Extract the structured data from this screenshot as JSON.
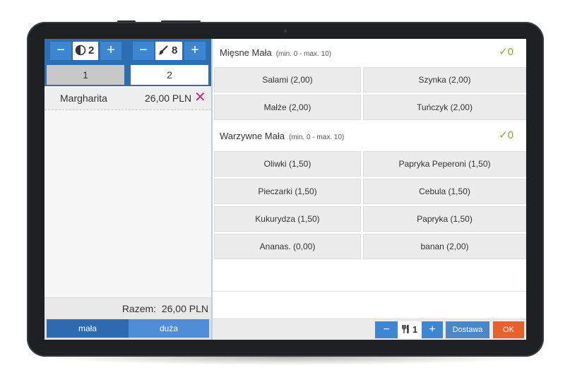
{
  "left": {
    "guests_count": "2",
    "table_count": "8",
    "tabs": [
      "1",
      "2"
    ],
    "order": {
      "name": "Margharita",
      "price": "26,00 PLN"
    },
    "total_label": "Razem:",
    "total_value": "26,00 PLN",
    "sizes": [
      "mała",
      "duża"
    ]
  },
  "right": {
    "sections": [
      {
        "title": "Mięsne Mała",
        "range": "(min. 0 - max. 10)",
        "count": "✓0",
        "options": [
          "Salami (2,00)",
          "Szynka (2,00)",
          "Małże (2,00)",
          "Tuńczyk (2,00)"
        ]
      },
      {
        "title": "Warzywne Mała",
        "range": "(min. 0 - max. 10)",
        "count": "✓0",
        "options": [
          "Oliwki (1,50)",
          "Papryka Peperoni (1,50)",
          "Pieczarki (1,50)",
          "Cebula (1,50)",
          "Kukurydza (1,50)",
          "Papryka (1,50)",
          "Ananas. (0,00)",
          "banan (2,00)"
        ]
      }
    ],
    "footer": {
      "qty": "1",
      "minus": "−",
      "plus": "+",
      "delivery": "Dostawa",
      "ok": "OK"
    }
  },
  "symbols": {
    "minus": "−",
    "plus": "+",
    "remove": "✕"
  },
  "colors": {
    "accent": "#2d6db4",
    "ok_button": "#e8612c",
    "check": "#7cae2e",
    "remove": "#d22a6b"
  }
}
